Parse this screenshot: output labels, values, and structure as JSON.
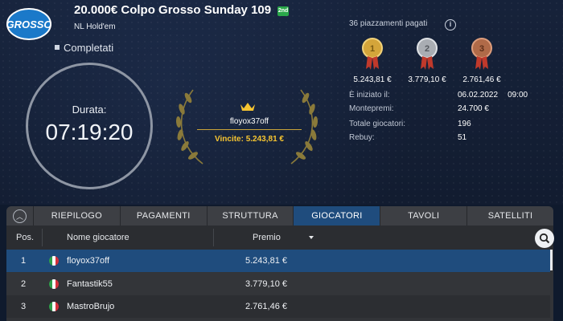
{
  "header": {
    "logo_text": "GROSSO",
    "title": "20.000€ Colpo Grosso Sunday 109",
    "badge": "2nd",
    "game_type": "NL Hold'em",
    "status": "Completati"
  },
  "clock": {
    "label": "Durata:",
    "time": "07:19:20"
  },
  "winner": {
    "name": "floyox37off",
    "prize": "Vincite: 5.243,81 €"
  },
  "payouts": {
    "paid_places": "36 piazzamenti pagati",
    "medals": [
      {
        "rank": "1",
        "amount": "5.243,81 €",
        "color": "#d4a53a"
      },
      {
        "rank": "2",
        "amount": "3.779,10 €",
        "color": "#a9adb3"
      },
      {
        "rank": "3",
        "amount": "2.761,46 €",
        "color": "#b06a48"
      }
    ]
  },
  "info": {
    "started_label": "È iniziato il:",
    "started_date": "06.02.2022",
    "started_time": "09:00",
    "prizepool_label": "Montepremi:",
    "prizepool": "24.700 €",
    "players_label": "Totale giocatori:",
    "players": "196",
    "rebuy_label": "Rebuy:",
    "rebuy": "51"
  },
  "tabs": [
    "RIEPILOGO",
    "PAGAMENTI",
    "STRUTTURA",
    "GIOCATORI",
    "TAVOLI",
    "SATELLITI"
  ],
  "active_tab": "GIOCATORI",
  "table": {
    "headers": {
      "pos": "Pos.",
      "name": "Nome giocatore",
      "prize": "Premio"
    },
    "rows": [
      {
        "pos": "1",
        "name": "floyox37off",
        "prize": "5.243,81 €"
      },
      {
        "pos": "2",
        "name": "Fantastik55",
        "prize": "3.779,10 €"
      },
      {
        "pos": "3",
        "name": "MastroBrujo",
        "prize": "2.761,46 €"
      }
    ]
  },
  "colors": {
    "accent": "#1f4c7d",
    "gold": "#f6c531"
  }
}
